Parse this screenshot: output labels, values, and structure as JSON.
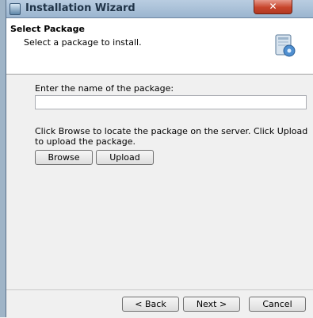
{
  "window": {
    "title": "Installation Wizard",
    "close_label": "✕",
    "title_icon": "installer-app-icon"
  },
  "header": {
    "title": "Select Package",
    "subtitle": "Select a package to install.",
    "icon": "package-install-icon"
  },
  "form": {
    "name_label": "Enter the name of the package:",
    "name_value": "",
    "instructions": "Click Browse to locate the package on the server. Click Upload to upload the package.",
    "browse_label": "Browse",
    "upload_label": "Upload"
  },
  "footer": {
    "back_label": "< Back",
    "next_label": "Next >",
    "cancel_label": "Cancel"
  },
  "colors": {
    "titlebar": "#b9cde1",
    "close_button": "#c7452c",
    "header_bg": "#ffffff",
    "dialog_bg": "#f0f0f0"
  }
}
